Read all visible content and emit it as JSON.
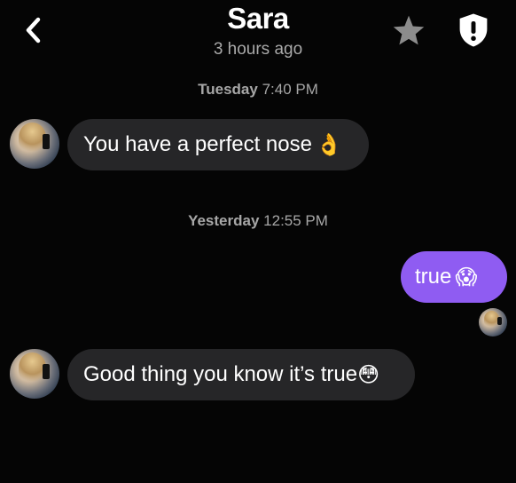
{
  "header": {
    "back_icon": "chevron-left-icon",
    "name": "Sara",
    "status": "3 hours ago",
    "star_icon": "star-icon",
    "report_icon": "shield-alert-icon"
  },
  "colors": {
    "background": "#050505",
    "received_bubble": "#262628",
    "sent_bubble": "#8f5cf2",
    "muted_text": "#a9a9a9"
  },
  "timestamps": [
    {
      "day": "Tuesday",
      "time": "7:40 PM"
    },
    {
      "day": "Yesterday",
      "time": "12:55 PM"
    }
  ],
  "messages": [
    {
      "direction": "received",
      "text": "You have a perfect nose",
      "emoji": "👌"
    },
    {
      "direction": "sent",
      "text": "true",
      "emoji": "😱"
    },
    {
      "direction": "received",
      "text": "Good thing you know it’s true",
      "emoji": "😳"
    }
  ]
}
